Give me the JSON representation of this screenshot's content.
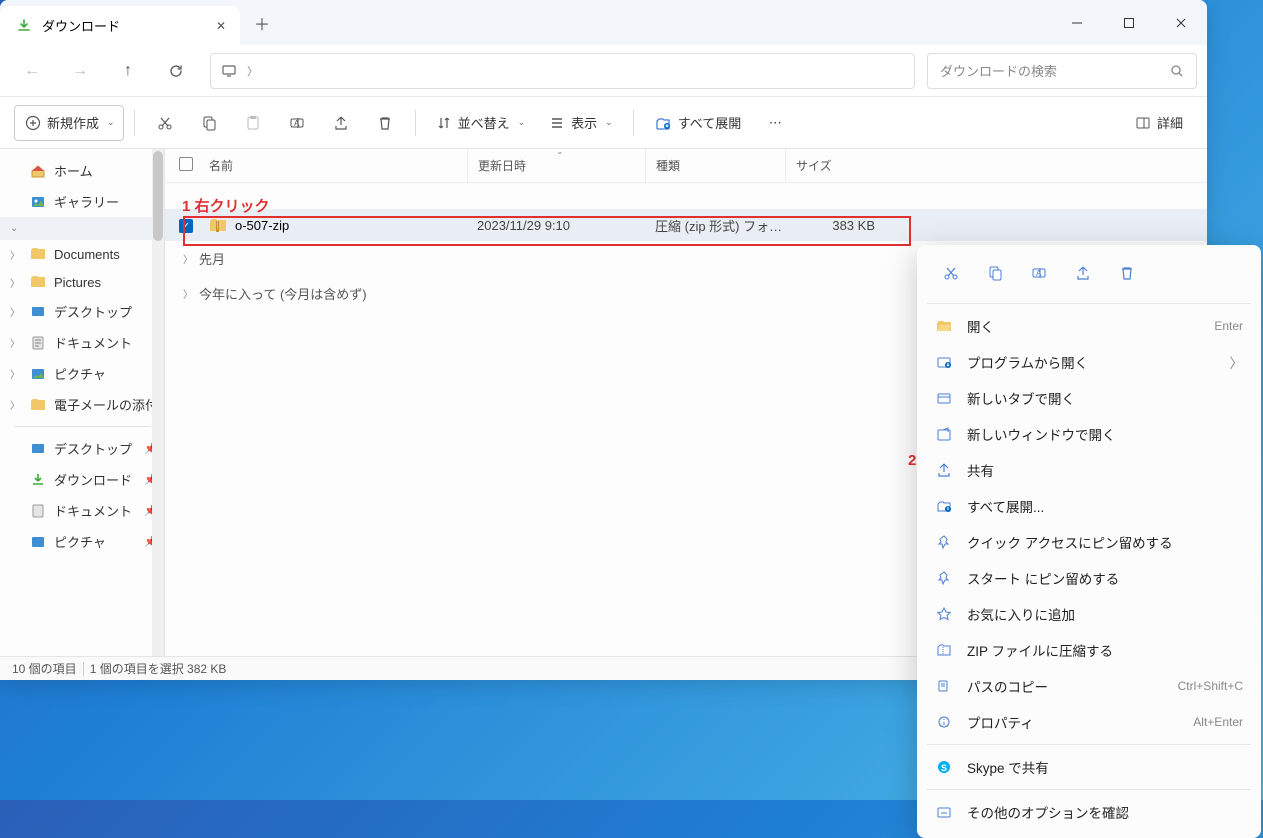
{
  "window": {
    "tab_title": "ダウンロード",
    "search_placeholder": "ダウンロードの検索"
  },
  "toolbar": {
    "new": "新規作成",
    "sort": "並べ替え",
    "view": "表示",
    "extract_all": "すべて展開",
    "details": "詳細"
  },
  "columns": {
    "name": "名前",
    "date": "更新日時",
    "type": "種類",
    "size": "サイズ"
  },
  "sidebar": {
    "home": "ホーム",
    "gallery": "ギャラリー",
    "documents": "Documents",
    "pictures": "Pictures",
    "desktop": "デスクトップ",
    "doc_jp": "ドキュメント",
    "pic_jp": "ピクチャ",
    "mail": "電子メールの添付",
    "q_desktop": "デスクトップ",
    "q_download": "ダウンロード",
    "q_doc": "ドキュメント",
    "q_pic": "ピクチャ"
  },
  "file": {
    "name": "o-507-zip",
    "date": "2023/11/29 9:10",
    "type": "圧縮 (zip 形式) フォル...",
    "size": "383 KB"
  },
  "groups": {
    "last_month": "先月",
    "this_year": "今年に入って (今月は含めず)"
  },
  "status": {
    "count": "10 個の項目",
    "selected": "1 個の項目を選択 382 KB"
  },
  "annotations": {
    "a1": "1 右クリック",
    "a2": "2"
  },
  "ctx": {
    "open": "開く",
    "open_sc": "Enter",
    "open_with": "プログラムから開く",
    "new_tab": "新しいタブで開く",
    "new_win": "新しいウィンドウで開く",
    "share": "共有",
    "extract": "すべて展開...",
    "pin_quick": "クイック アクセスにピン留めする",
    "pin_start": "スタート にピン留めする",
    "favorite": "お気に入りに追加",
    "compress": "ZIP ファイルに圧縮する",
    "copy_path": "パスのコピー",
    "copy_path_sc": "Ctrl+Shift+C",
    "properties": "プロパティ",
    "properties_sc": "Alt+Enter",
    "skype": "Skype で共有",
    "more": "その他のオプションを確認"
  }
}
